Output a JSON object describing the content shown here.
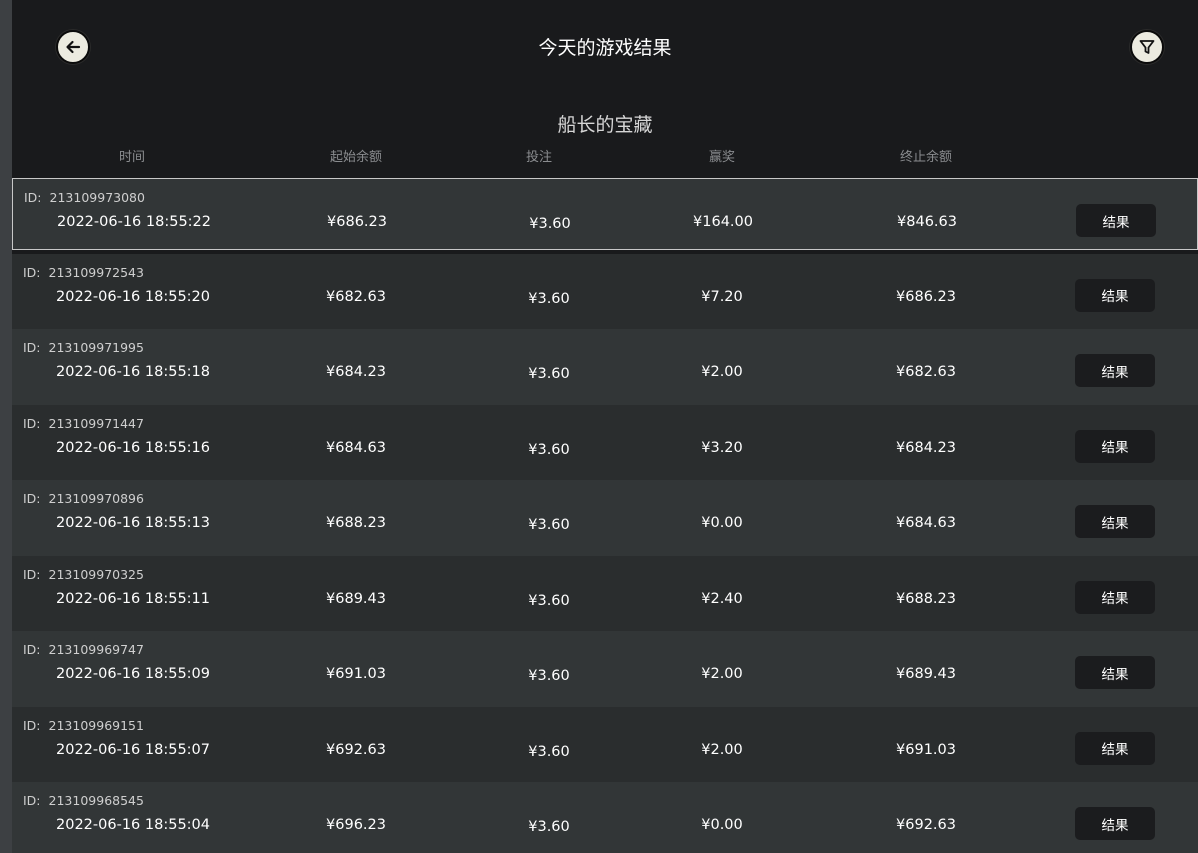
{
  "header": {
    "title": "今天的游戏结果",
    "back_icon": "arrow-left-icon",
    "filter_icon": "filter-icon"
  },
  "game_name": "船长的宝藏",
  "columns": [
    "时间",
    "起始余额",
    "投注",
    "赢奖",
    "终止余额"
  ],
  "id_label": "ID:",
  "result_label": "结果",
  "rows": [
    {
      "id": "213109973080",
      "time": "2022-06-16 18:55:22",
      "start": "¥686.23",
      "bet": "¥3.60",
      "win": "¥164.00",
      "end": "¥846.63",
      "selected": true
    },
    {
      "id": "213109972543",
      "time": "2022-06-16 18:55:20",
      "start": "¥682.63",
      "bet": "¥3.60",
      "win": "¥7.20",
      "end": "¥686.23"
    },
    {
      "id": "213109971995",
      "time": "2022-06-16 18:55:18",
      "start": "¥684.23",
      "bet": "¥3.60",
      "win": "¥2.00",
      "end": "¥682.63"
    },
    {
      "id": "213109971447",
      "time": "2022-06-16 18:55:16",
      "start": "¥684.63",
      "bet": "¥3.60",
      "win": "¥3.20",
      "end": "¥684.23"
    },
    {
      "id": "213109970896",
      "time": "2022-06-16 18:55:13",
      "start": "¥688.23",
      "bet": "¥3.60",
      "win": "¥0.00",
      "end": "¥684.63"
    },
    {
      "id": "213109970325",
      "time": "2022-06-16 18:55:11",
      "start": "¥689.43",
      "bet": "¥3.60",
      "win": "¥2.40",
      "end": "¥688.23"
    },
    {
      "id": "213109969747",
      "time": "2022-06-16 18:55:09",
      "start": "¥691.03",
      "bet": "¥3.60",
      "win": "¥2.00",
      "end": "¥689.43"
    },
    {
      "id": "213109969151",
      "time": "2022-06-16 18:55:07",
      "start": "¥692.63",
      "bet": "¥3.60",
      "win": "¥2.00",
      "end": "¥691.03"
    },
    {
      "id": "213109968545",
      "time": "2022-06-16 18:55:04",
      "start": "¥696.23",
      "bet": "¥3.60",
      "win": "¥0.00",
      "end": "¥692.63"
    }
  ]
}
